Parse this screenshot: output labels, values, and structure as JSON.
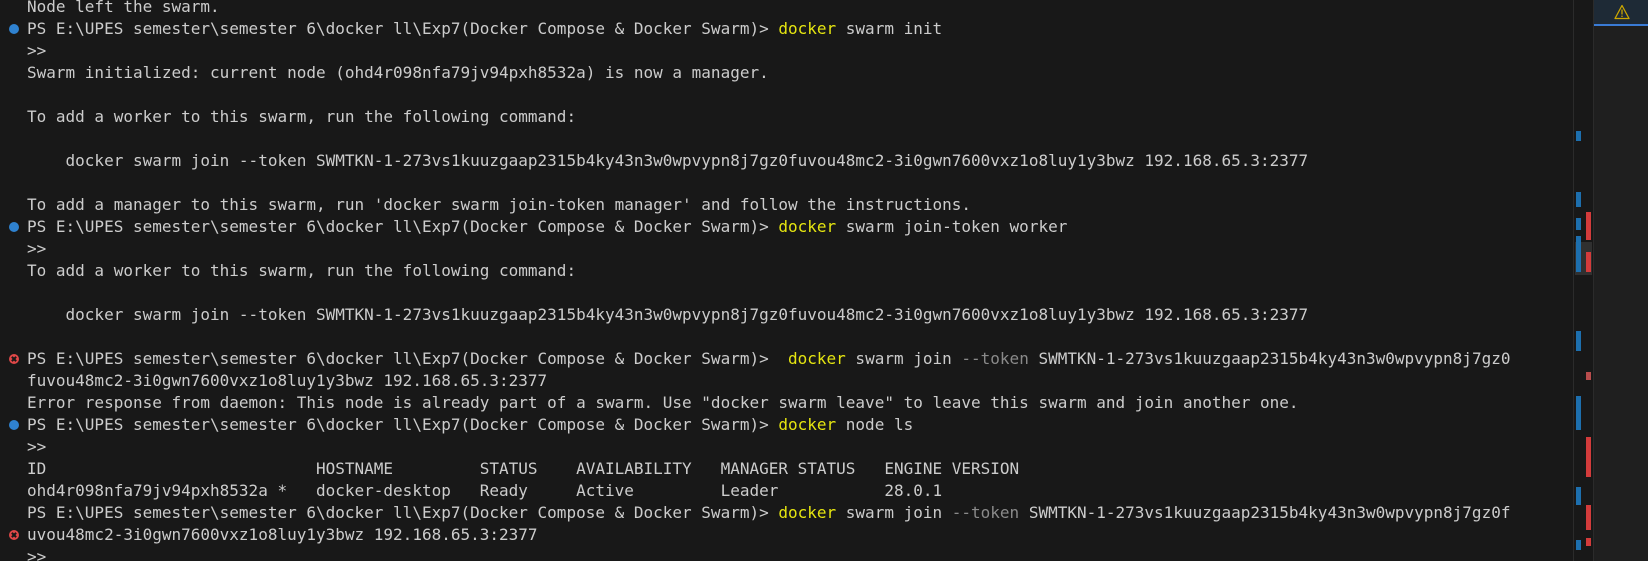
{
  "terminal": {
    "lines": [
      {
        "deco": "",
        "segments": [
          {
            "t": "Node left the swarm.",
            "c": ""
          }
        ]
      },
      {
        "deco": "ok",
        "segments": [
          {
            "t": "PS E:\\UPES semester\\semester 6\\docker ll\\Exp7(Docker Compose & Docker Swarm)> ",
            "c": ""
          },
          {
            "t": "docker",
            "c": "cmd"
          },
          {
            "t": " swarm init",
            "c": ""
          }
        ]
      },
      {
        "deco": "",
        "segments": [
          {
            "t": ">>",
            "c": ""
          }
        ]
      },
      {
        "deco": "",
        "segments": [
          {
            "t": "Swarm initialized: current node (ohd4r098nfa79jv94pxh8532a) is now a manager.",
            "c": ""
          }
        ]
      },
      {
        "deco": "",
        "segments": []
      },
      {
        "deco": "",
        "segments": [
          {
            "t": "To add a worker to this swarm, run the following command:",
            "c": ""
          }
        ]
      },
      {
        "deco": "",
        "segments": []
      },
      {
        "deco": "",
        "segments": [
          {
            "t": "    docker swarm join --token SWMTKN-1-273vs1kuuzgaap2315b4ky43n3w0wpvypn8j7gz0fuvou48mc2-3i0gwn7600vxz1o8luy1y3bwz 192.168.65.3:2377",
            "c": ""
          }
        ]
      },
      {
        "deco": "",
        "segments": []
      },
      {
        "deco": "",
        "segments": [
          {
            "t": "To add a manager to this swarm, run 'docker swarm join-token manager' and follow the instructions.",
            "c": ""
          }
        ]
      },
      {
        "deco": "ok",
        "segments": [
          {
            "t": "PS E:\\UPES semester\\semester 6\\docker ll\\Exp7(Docker Compose & Docker Swarm)> ",
            "c": ""
          },
          {
            "t": "docker",
            "c": "cmd"
          },
          {
            "t": " swarm join-token worker",
            "c": ""
          }
        ]
      },
      {
        "deco": "",
        "segments": [
          {
            "t": ">>",
            "c": ""
          }
        ]
      },
      {
        "deco": "",
        "segments": [
          {
            "t": "To add a worker to this swarm, run the following command:",
            "c": ""
          }
        ]
      },
      {
        "deco": "",
        "segments": []
      },
      {
        "deco": "",
        "segments": [
          {
            "t": "    docker swarm join --token SWMTKN-1-273vs1kuuzgaap2315b4ky43n3w0wpvypn8j7gz0fuvou48mc2-3i0gwn7600vxz1o8luy1y3bwz 192.168.65.3:2377",
            "c": ""
          }
        ]
      },
      {
        "deco": "",
        "segments": []
      },
      {
        "deco": "err",
        "segments": [
          {
            "t": "PS E:\\UPES semester\\semester 6\\docker ll\\Exp7(Docker Compose & Docker Swarm)>  ",
            "c": ""
          },
          {
            "t": "docker",
            "c": "cmd"
          },
          {
            "t": " swarm join ",
            "c": ""
          },
          {
            "t": "--token",
            "c": "flag"
          },
          {
            "t": " SWMTKN-1-273vs1kuuzgaap2315b4ky43n3w0wpvypn8j7gz0",
            "c": ""
          }
        ]
      },
      {
        "deco": "",
        "segments": [
          {
            "t": "fuvou48mc2-3i0gwn7600vxz1o8luy1y3bwz 192.168.65.3:2377",
            "c": ""
          }
        ]
      },
      {
        "deco": "",
        "segments": [
          {
            "t": "Error response from daemon: This node is already part of a swarm. Use \"docker swarm leave\" to leave this swarm and join another one.",
            "c": ""
          }
        ]
      },
      {
        "deco": "ok",
        "segments": [
          {
            "t": "PS E:\\UPES semester\\semester 6\\docker ll\\Exp7(Docker Compose & Docker Swarm)> ",
            "c": ""
          },
          {
            "t": "docker",
            "c": "cmd"
          },
          {
            "t": " node ls",
            "c": ""
          }
        ]
      },
      {
        "deco": "",
        "segments": [
          {
            "t": ">>",
            "c": ""
          }
        ]
      },
      {
        "deco": "",
        "segments": [
          {
            "t": "ID                            HOSTNAME         STATUS    AVAILABILITY   MANAGER STATUS   ENGINE VERSION",
            "c": ""
          }
        ]
      },
      {
        "deco": "",
        "segments": [
          {
            "t": "ohd4r098nfa79jv94pxh8532a *   docker-desktop   Ready     Active         Leader           28.0.1",
            "c": ""
          }
        ]
      },
      {
        "deco": "",
        "segments": [
          {
            "t": "PS E:\\UPES semester\\semester 6\\docker ll\\Exp7(Docker Compose & Docker Swarm)> ",
            "c": ""
          },
          {
            "t": "docker",
            "c": "cmd"
          },
          {
            "t": " swarm join ",
            "c": ""
          },
          {
            "t": "--token",
            "c": "flag"
          },
          {
            "t": " SWMTKN-1-273vs1kuuzgaap2315b4ky43n3w0wpvypn8j7gz0f",
            "c": ""
          }
        ]
      },
      {
        "deco": "err",
        "segments": [
          {
            "t": "uvou48mc2-3i0gwn7600vxz1o8luy1y3bwz 192.168.65.3:2377",
            "c": ""
          }
        ]
      },
      {
        "deco": "",
        "segments": [
          {
            "t": ">>",
            "c": ""
          }
        ]
      }
    ]
  },
  "colors": {
    "background": "#181818",
    "text": "#cccccc",
    "command": "#e5e510",
    "flag": "#8a8a8a",
    "success_deco": "#2f82d0",
    "error_deco": "#e04848"
  },
  "side_panel": {
    "icon": "warning-icon"
  }
}
